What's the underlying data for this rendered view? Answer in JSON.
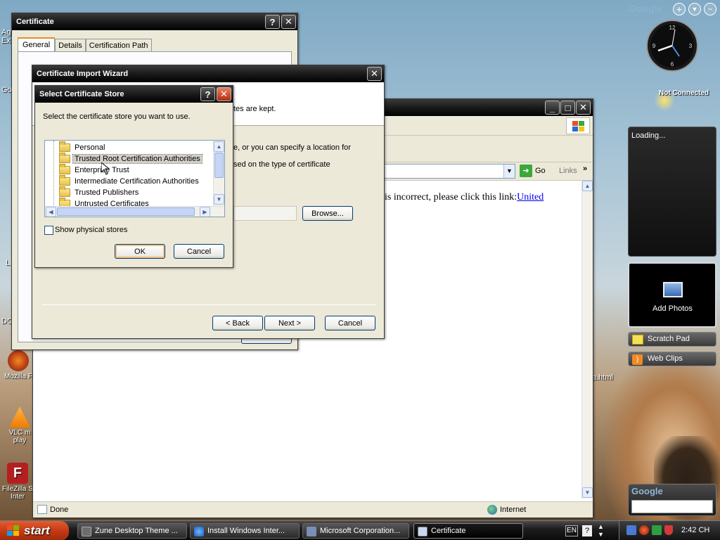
{
  "desktop": {
    "icons": [
      {
        "label": "Mozilla F"
      },
      {
        "label": "VLC m\nplay"
      },
      {
        "label": "FileZilla S\nInter"
      }
    ],
    "file_label": "a.html"
  },
  "certificate_window": {
    "title": "Certificate",
    "tabs": [
      "General",
      "Details",
      "Certification Path"
    ]
  },
  "import_wizard": {
    "title": "Certificate Import Wizard",
    "text1": "tes are kept.",
    "text2": "e, or you can specify a location for",
    "text3": "sed on the type of certificate",
    "browse_label": "Browse...",
    "back_label": "< Back",
    "next_label": "Next >",
    "cancel_label": "Cancel"
  },
  "select_store": {
    "title": "Select Certificate Store",
    "instruction": "Select the certificate store you want to use.",
    "stores": [
      "Personal",
      "Trusted Root Certification Authorities",
      "Enterprise Trust",
      "Intermediate Certification Authorities",
      "Trusted Publishers",
      "Untrusted Certificates"
    ],
    "selected_index": 1,
    "show_physical_label": "Show physical stores",
    "ok_label": "OK",
    "cancel_label": "Cancel"
  },
  "browser": {
    "go_label": "Go",
    "links_label": "Links",
    "body_text": "is incorrect, please click this link:",
    "link_text": "United",
    "status_text": "Done",
    "zone_text": "Internet"
  },
  "sidebar": {
    "google_label": "Google",
    "clock_status": "Not Connected",
    "loading_text": "Loading...",
    "add_photos_label": "Add Photos",
    "scratch_pad_label": "Scratch Pad",
    "web_clips_label": "Web Clips",
    "search_google_label": "Google"
  },
  "taskbar": {
    "start_label": "start",
    "tasks": [
      {
        "label": "Zune Desktop Theme ..."
      },
      {
        "label": "Install Windows Inter..."
      },
      {
        "label": "Microsoft Corporation..."
      },
      {
        "label": "Certificate"
      }
    ],
    "lang": "EN",
    "time": "2:42 CH"
  }
}
